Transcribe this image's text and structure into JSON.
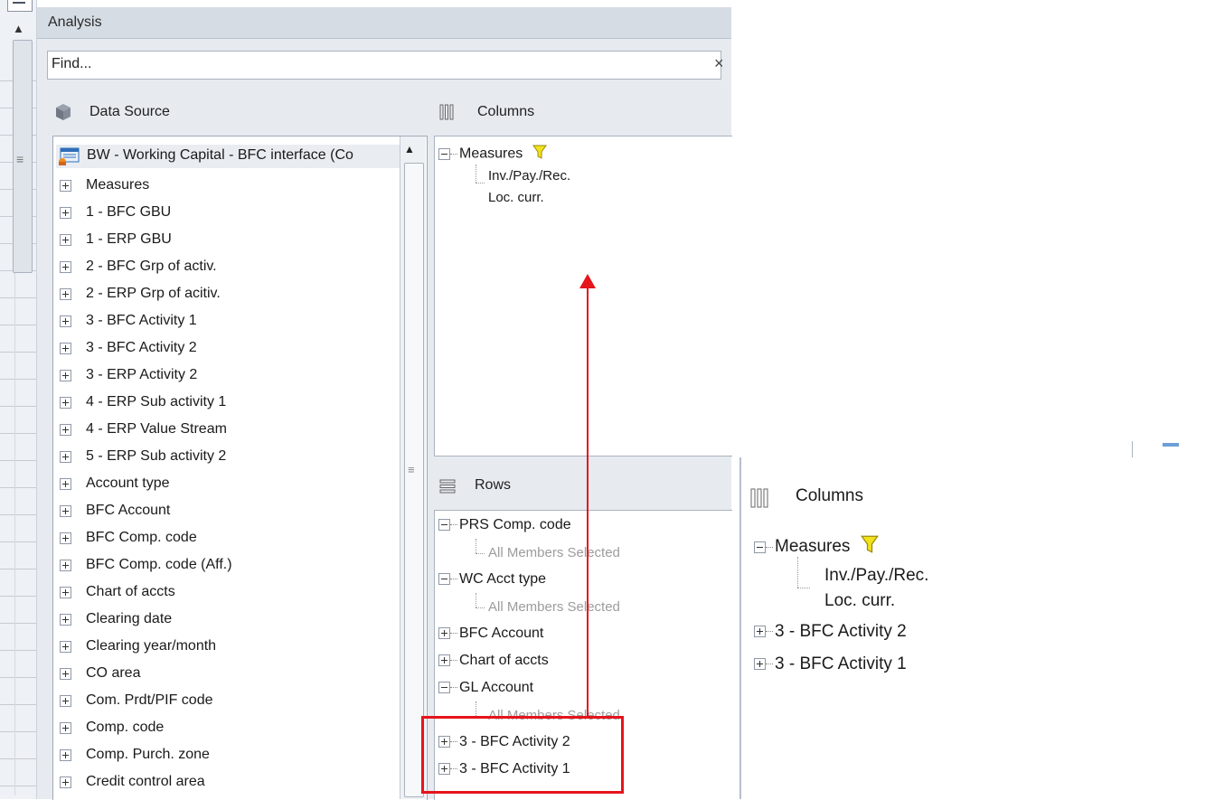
{
  "panel": {
    "title": "Analysis"
  },
  "find": {
    "placeholder": "Find...",
    "clear_glyph": "×"
  },
  "data_source": {
    "header": "Data Source",
    "root": "BW - Working Capital - BFC interface (Co",
    "items": [
      "Measures",
      "1 - BFC GBU",
      "1 - ERP GBU",
      "2 - BFC Grp of activ.",
      "2 - ERP Grp of acitiv.",
      "3 - BFC Activity 1",
      "3 - BFC Activity 2",
      "3 - ERP Activity 2",
      "4 - ERP Sub activity 1",
      "4 - ERP Value Stream",
      "5 - ERP Sub activity 2",
      "Account type",
      "BFC Account",
      "BFC Comp. code",
      "BFC Comp. code (Aff.)",
      "Chart of accts",
      "Clearing date",
      "Clearing year/month",
      "CO area",
      "Com. Prdt/PIF code",
      "Comp. code",
      "Comp. Purch. zone",
      "Credit control area"
    ]
  },
  "columns": {
    "header": "Columns",
    "measures_label": "Measures",
    "measure_value_line1": "Inv./Pay./Rec.",
    "measure_value_line2": "Loc. curr."
  },
  "rows": {
    "header": "Rows",
    "items": [
      {
        "label": "PRS Comp. code",
        "expanded": true,
        "child": "All Members Selected"
      },
      {
        "label": "WC Acct type",
        "expanded": true,
        "child": "All Members Selected"
      },
      {
        "label": "BFC Account",
        "expanded": false
      },
      {
        "label": "Chart of accts",
        "expanded": false
      },
      {
        "label": "GL Account",
        "expanded": true,
        "child": "All Members Selected"
      },
      {
        "label": "3 - BFC Activity 2",
        "expanded": false
      },
      {
        "label": "3 - BFC Activity 1",
        "expanded": false
      }
    ]
  },
  "inset": {
    "header": "Columns",
    "measures_label": "Measures",
    "measure_value_line1": "Inv./Pay./Rec.",
    "measure_value_line2": "Loc. curr.",
    "items": [
      "3 - BFC Activity 2",
      "3 - BFC Activity 1"
    ]
  },
  "colors": {
    "annotation": "#e6141b",
    "filter_icon": "#f2e21a"
  }
}
